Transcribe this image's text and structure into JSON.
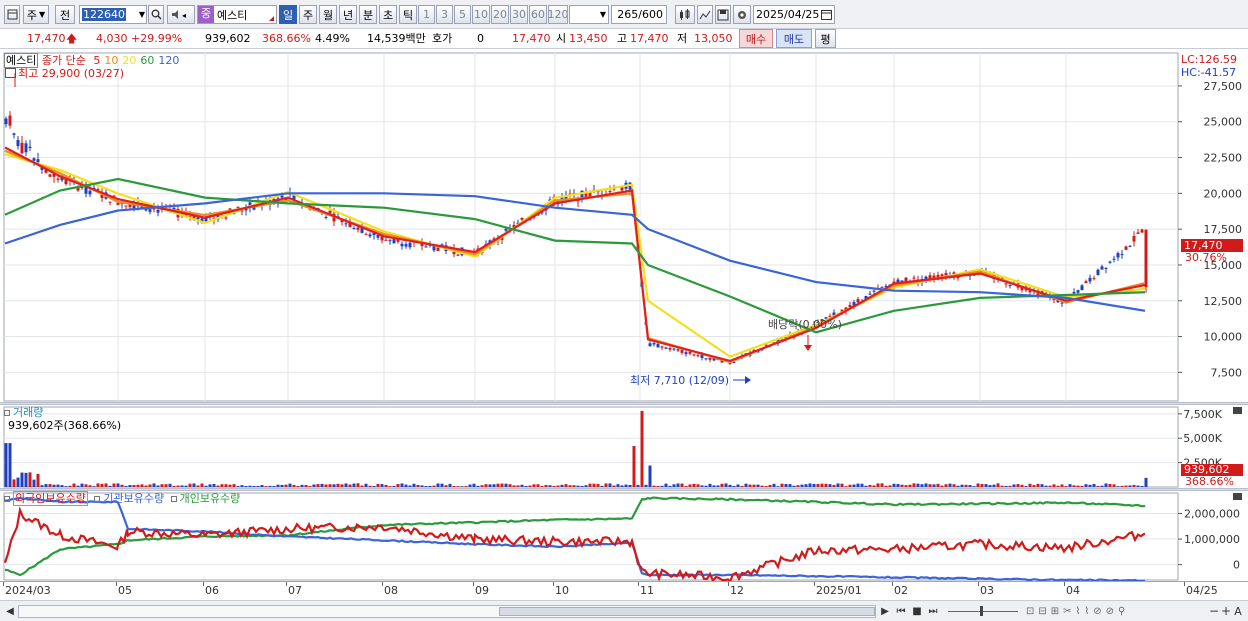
{
  "toolbar": {
    "kind": "주",
    "period_mode": "전",
    "code": "122640",
    "stock_name": "예스티",
    "market_badge": "중",
    "periods": [
      "일",
      "주",
      "월",
      "년",
      "분",
      "초",
      "틱"
    ],
    "intervals": [
      "1",
      "3",
      "5",
      "10",
      "20",
      "30",
      "60",
      "120"
    ],
    "count": "265",
    "count_max": "/600",
    "date": "2025/04/25"
  },
  "quote": {
    "price": "17,470",
    "change": "4,030",
    "change_rate": "+29.99%",
    "volume": "939,602",
    "volume_ratio": "368.66%",
    "turnover": "4.49%",
    "amount": "14,539백만",
    "bid_label": "호가",
    "bid_value": "0",
    "bid_price": "17,470",
    "open_label": "시",
    "open": "13,450",
    "high_label": "고",
    "high": "17,470",
    "low_label": "저",
    "low": "13,050",
    "buy_label": "매수",
    "sell_label": "매도",
    "avg_label": "평"
  },
  "price_panel": {
    "name": "예스티",
    "ma_label": "종가 단순",
    "ma_periods": [
      "5",
      "10",
      "20",
      "60",
      "120"
    ],
    "high_note": "최고 29,900 (03/27)",
    "low_note": "최저 7,710 (12/09)",
    "dividend_note": "배당락(0.00%)",
    "lc": "LC:126.59",
    "hc": "HC:-41.57",
    "last_price": "17,470",
    "last_rate": "30.76%",
    "y_ticks": [
      "27,500",
      "25,000",
      "22,500",
      "20,000",
      "17,500",
      "15,000",
      "12,500",
      "10,000",
      "7,500"
    ]
  },
  "volume_panel": {
    "title": "거래량",
    "value_note": "939,602주(368.66%)",
    "last_value": "939,602",
    "last_rate": "368.66%",
    "y_ticks": [
      "7,500K",
      "5,000K",
      "2,500K"
    ]
  },
  "holdings_panel": {
    "legend": [
      "외국인보유수량",
      "기관보유수량",
      "개인보유수량"
    ],
    "y_ticks": [
      "2,000,000",
      "1,000,000",
      "0"
    ]
  },
  "x_axis": [
    "2024/03",
    "05",
    "06",
    "07",
    "08",
    "09",
    "10",
    "11",
    "12",
    "2025/01",
    "02",
    "03",
    "04",
    "04/25"
  ],
  "colors": {
    "up": "#d21a1a",
    "down": "#1f3fc4",
    "ma5": "#e02020",
    "ma10": "#f08c1e",
    "ma20": "#f2e020",
    "ma60": "#2a9a3a",
    "ma120": "#3a64d8",
    "foreign": "#d21a1a",
    "institution": "#3a64d8",
    "individual": "#2a9a3a"
  },
  "chart_data": {
    "type": "line",
    "x": [
      "2024-03",
      "2024-04",
      "2024-05",
      "2024-06",
      "2024-07",
      "2024-08",
      "2024-09",
      "2024-10",
      "2024-10-31",
      "2024-11",
      "2024-12",
      "2025-01",
      "2025-02",
      "2025-03",
      "2025-04",
      "2025-04-25"
    ],
    "series": [
      {
        "name": "종가",
        "values": [
          23000,
          21000,
          19500,
          18200,
          19800,
          16800,
          15800,
          19500,
          20500,
          9500,
          8200,
          10800,
          13800,
          14500,
          12400,
          17470
        ]
      },
      {
        "name": "5",
        "values": [
          23200,
          21200,
          19600,
          18300,
          19700,
          17000,
          15900,
          19300,
          20200,
          9800,
          8300,
          10600,
          13700,
          14400,
          12500,
          13600
        ]
      },
      {
        "name": "60",
        "values": [
          18500,
          20200,
          21000,
          19700,
          19300,
          19000,
          18200,
          16700,
          16500,
          15000,
          12800,
          10300,
          11800,
          12700,
          12900,
          13100
        ]
      },
      {
        "name": "120",
        "values": [
          16500,
          17800,
          18800,
          19300,
          20000,
          20000,
          19800,
          19000,
          18500,
          17500,
          15300,
          13800,
          13200,
          13100,
          12700,
          11800
        ]
      }
    ]
  }
}
